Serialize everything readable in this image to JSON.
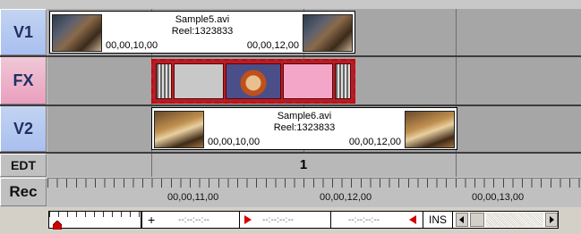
{
  "tracks": {
    "v1": "V1",
    "fx": "FX",
    "v2": "V2",
    "edt": "EDT",
    "rec": "Rec"
  },
  "clip1": {
    "name": "Sample5.avi",
    "reel": "Reel:1323833",
    "tc_in": "00,00,10,00",
    "tc_out": "00,00,12,00"
  },
  "clip2": {
    "name": "Sample6.avi",
    "reel": "Reel:1323833",
    "tc_in": "00,00,10,00",
    "tc_out": "00,00,12,00"
  },
  "edit": {
    "number": "1"
  },
  "ruler": {
    "labels": [
      "00,00,11,00",
      "00,00,12,00",
      "00,00,13,00"
    ]
  },
  "controls": {
    "plus": "+",
    "tc_a": "--:--:--:--",
    "tc_b": "--:--:--:--",
    "tc_c": "--:--:--:--",
    "mode": "INS"
  },
  "colors": {
    "mark": "#d40000",
    "fx_border": "#cc0000",
    "v_header": "#a9bff0",
    "fx_header": "#ea9fbe"
  },
  "icons": [
    "mark-in-icon",
    "mark-out-icon",
    "scroll-left-icon",
    "scroll-right-icon",
    "playhead-icon"
  ]
}
